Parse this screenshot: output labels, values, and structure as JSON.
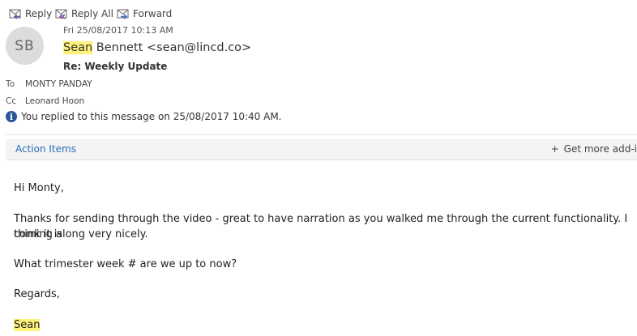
{
  "toolbar": {
    "reply_label": "Reply",
    "reply_all_label": "Reply All",
    "forward_label": "Forward"
  },
  "message": {
    "avatar_initials": "SB",
    "date": "Fri 25/08/2017 10:13 AM",
    "sender_first": "Sean",
    "sender_rest": " Bennett <sean@lincd.co>",
    "subject": "Re: Weekly Update",
    "to_label": "To",
    "to_value": "MONTY PANDAY",
    "cc_label": "Cc",
    "cc_value": "Leonard Hoon",
    "info_text": "You replied to this message on 25/08/2017 10:40 AM."
  },
  "addins": {
    "action_items_label": "Action Items",
    "get_more_label": "Get more add-i"
  },
  "body": {
    "greeting": "Hi Monty,",
    "para1_line1": "Thanks for sending through the video - great to have narration as you walked me through the current functionality. I think it is",
    "para1_line2": "coming along very nicely.",
    "question": "What trimester week # are we up to now?",
    "signoff": "Regards,",
    "signature": "Sean"
  },
  "colors": {
    "highlight": "#fff27a",
    "link": "#2b6cb8",
    "info_icon": "#2b579a",
    "icon_purple": "#7a4fa3"
  }
}
